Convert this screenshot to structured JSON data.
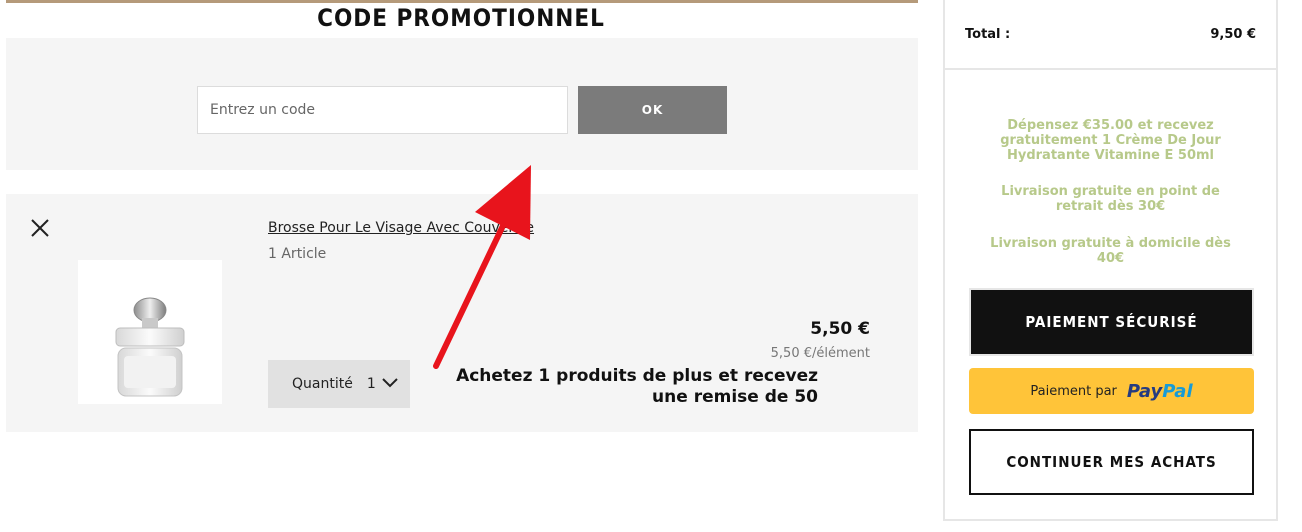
{
  "promo": {
    "title": "CODE PROMOTIONNEL",
    "input_placeholder": "Entrez un code",
    "input_value": "",
    "ok_label": "OK"
  },
  "cart_item": {
    "name": "Brosse Pour Le Visage Avec Couvercle",
    "count": "1 Article",
    "price": "5,50 €",
    "unit_price": "5,50 €/élément",
    "quantity_label": "Quantité",
    "quantity_value": "1",
    "offer": "Achetez 1 produits de plus et recevez une remise de 50",
    "image_icon": "face-brush-jar-icon"
  },
  "summary": {
    "total_label": "Total :",
    "total_value": "9,50 €",
    "messages": [
      "Dépensez €35.00 et recevez gratuitement 1 Crème De Jour Hydratante Vitamine E 50ml",
      "Livraison gratuite en point de retrait dès 30€",
      "Livraison gratuite à domicile dès 40€"
    ],
    "secure_payment_label": "PAIEMENT SÉCURISÉ",
    "paypal_prefix": "Paiement par",
    "paypal_brand_1": "Pay",
    "paypal_brand_2": "Pal",
    "continue_label": "CONTINUER MES ACHATS"
  },
  "colors": {
    "promo_message": "#b7c98a",
    "annotation_arrow": "#e8141c",
    "paypal_button": "#ffc439"
  }
}
